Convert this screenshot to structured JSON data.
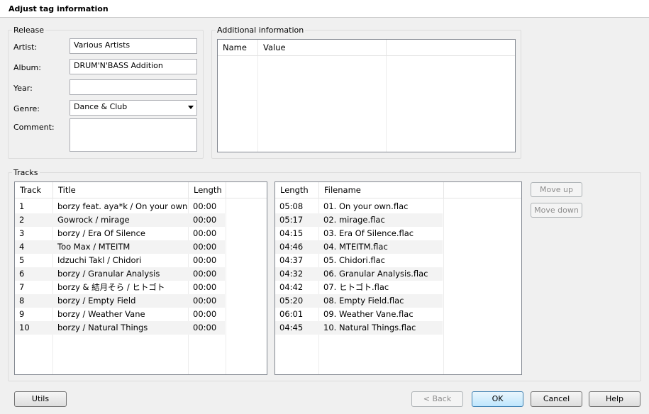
{
  "dialog": {
    "title": "Adjust tag information"
  },
  "release": {
    "label": "Release",
    "artist_label": "Artist:",
    "artist_value": "Various Artists",
    "album_label": "Album:",
    "album_value": "DRUM'N'BASS Addition",
    "year_label": "Year:",
    "year_value": "",
    "genre_label": "Genre:",
    "genre_value": "Dance & Club",
    "comment_label": "Comment:",
    "comment_value": ""
  },
  "additional": {
    "label": "Additional information",
    "columns": [
      "Name",
      "Value"
    ]
  },
  "tracks": {
    "label": "Tracks",
    "columns": [
      "Track",
      "Title",
      "Length"
    ],
    "rows": [
      [
        "1",
        "borzy feat. aya*k / On your own",
        "00:00"
      ],
      [
        "2",
        "Gowrock / mirage",
        "00:00"
      ],
      [
        "3",
        "borzy / Era Of Silence",
        "00:00"
      ],
      [
        "4",
        "Too Max / MTEITM",
        "00:00"
      ],
      [
        "5",
        "Idzuchi Takl / Chidori",
        "00:00"
      ],
      [
        "6",
        "borzy / Granular Analysis",
        "00:00"
      ],
      [
        "7",
        "borzy & 結月そら / ヒトゴト",
        "00:00"
      ],
      [
        "8",
        "borzy / Empty Field",
        "00:00"
      ],
      [
        "9",
        "borzy / Weather Vane",
        "00:00"
      ],
      [
        "10",
        "borzy / Natural Things",
        "00:00"
      ]
    ]
  },
  "files": {
    "columns": [
      "Length",
      "Filename"
    ],
    "rows": [
      [
        "05:08",
        "01. On your own.flac"
      ],
      [
        "05:17",
        "02. mirage.flac"
      ],
      [
        "04:15",
        "03. Era Of Silence.flac"
      ],
      [
        "04:46",
        "04. MTEITM.flac"
      ],
      [
        "04:37",
        "05. Chidori.flac"
      ],
      [
        "04:32",
        "06. Granular Analysis.flac"
      ],
      [
        "04:42",
        "07. ヒトゴト.flac"
      ],
      [
        "05:20",
        "08. Empty Field.flac"
      ],
      [
        "06:01",
        "09. Weather Vane.flac"
      ],
      [
        "04:45",
        "10. Natural Things.flac"
      ]
    ]
  },
  "buttons": {
    "move_up": "Move up",
    "move_down": "Move down",
    "utils": "Utils",
    "back": "< Back",
    "ok": "OK",
    "cancel": "Cancel",
    "help": "Help"
  }
}
